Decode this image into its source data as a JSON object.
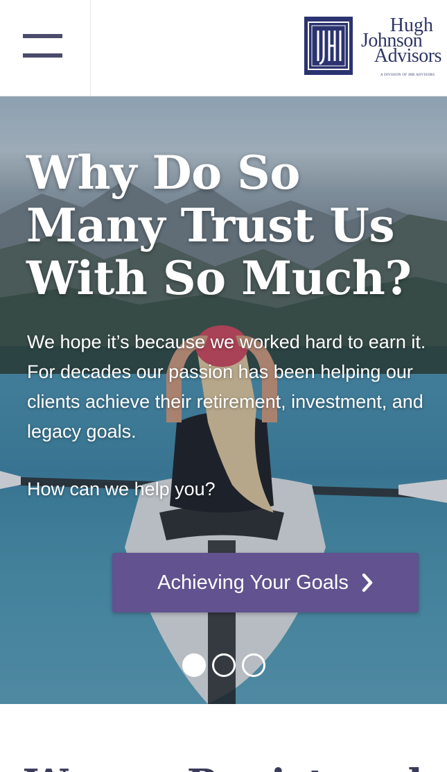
{
  "header": {
    "menu_icon": "hamburger-icon",
    "logo": {
      "mark_letters": "HJA",
      "line1": "Hugh",
      "line2": "Johnson",
      "line3": "Advisors",
      "tagline": "A DIVISION OF JHR ADVISORS"
    }
  },
  "hero": {
    "title": "Why Do So Many Trust Us With So Much?",
    "body": "We hope it’s because we worked hard to earn it. For decades our passion has been helping our clients achieve their retirement, investment, and legacy goals.",
    "question": "How can we help you?",
    "cta_label": "Achieving Your Goals",
    "cta_icon": "chevron-right-icon",
    "slides": {
      "count": 3,
      "active_index": 0
    }
  },
  "below": {
    "heading": "We are Registered"
  },
  "colors": {
    "brand_navy": "#2b3370",
    "cta_purple": "#62528f",
    "menu_icon": "#4b4b6b"
  }
}
